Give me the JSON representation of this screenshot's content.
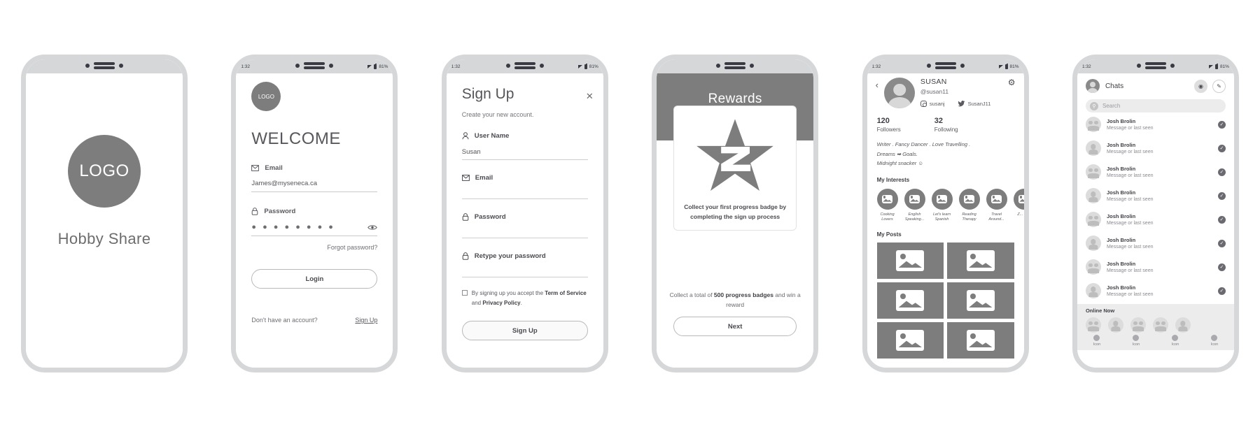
{
  "meta": {
    "status_time": "1:32",
    "battery": "81%",
    "accent_gray": "#7d7d7d",
    "frame_gray": "#d6d7d9"
  },
  "screens": [
    {
      "id": "splash",
      "name": "Splash Screen",
      "logo_text": "LOGO",
      "app_title": "Hobby Share"
    },
    {
      "id": "login",
      "name": "Login Screen",
      "logo_text": "LOGO",
      "heading": "WELCOME",
      "email": {
        "label": "Email",
        "value": "James@myseneca.ca",
        "icon": "envelope-icon"
      },
      "password": {
        "label": "Password",
        "value": "● ● ● ● ● ● ● ●",
        "icon": "lock-icon",
        "toggle_icon": "eye-icon"
      },
      "forgot_label": "Forgot password?",
      "login_button": "Login",
      "footer_question": "Don't have an account?",
      "footer_link": "Sign Up"
    },
    {
      "id": "signup",
      "name": "Sign Up Screen",
      "close_icon": "✕",
      "title": "Sign Up",
      "subtitle": "Create your new account.",
      "fields": [
        {
          "label": "User Name",
          "value": "Susan",
          "icon": "user-icon"
        },
        {
          "label": "Email",
          "value": "",
          "icon": "envelope-icon"
        },
        {
          "label": "Password",
          "value": "",
          "icon": "lock-icon"
        },
        {
          "label": "Retype your password",
          "value": "",
          "icon": "lock-icon"
        }
      ],
      "terms_prefix": "By signing up you accept the ",
      "terms_link_1": "Term of Service",
      "terms_mid": " and ",
      "terms_link_2": "Privacy Policy",
      "terms_suffix": ".",
      "signup_button": "Sign Up"
    },
    {
      "id": "rewards",
      "name": "Rewards Screen",
      "title": "Rewards",
      "badge_icon": "star-z-badge-icon",
      "card_caption": "Collect your first progress badge by completing the sign up process",
      "sub_prefix": "Collect a total of ",
      "sub_bold": "500 progress badges",
      "sub_suffix": " and win a reward",
      "next_button": "Next"
    },
    {
      "id": "profile",
      "name": "Profile Screen",
      "back_icon": "chevron-left-icon",
      "settings_icon": "gear-icon",
      "display_name": "SUSAN",
      "handle": "@susan11",
      "socials": [
        {
          "platform": "instagram",
          "handle": "susanj"
        },
        {
          "platform": "twitter",
          "handle": "SusanJ11"
        }
      ],
      "stats": [
        {
          "value": "120",
          "label": "Followers"
        },
        {
          "value": "32",
          "label": "Following"
        }
      ],
      "bio_lines": [
        "Writer .  Fancy Dancer .  Love Travelling .",
        "Dreams ➡ Goals.",
        "Midnight snacker ☺"
      ],
      "interests_title": "My Interests",
      "interests": [
        "Cooking Lovers",
        "English Speaking...",
        "Let's learn Spanish",
        "Reading Therapy",
        "Travel Around...",
        "Z... O..."
      ],
      "posts_title": "My Posts",
      "post_count": 6
    },
    {
      "id": "chats",
      "name": "Chats Screen",
      "title": "Chats",
      "camera_icon": "camera-icon",
      "compose_icon": "pencil-icon",
      "search_placeholder": "Search",
      "search_icon": "search-icon",
      "chats": [
        {
          "name": "Josh Brolin",
          "preview": "Message or last seen",
          "avatar": "group",
          "status_icon": "check-circle-icon"
        },
        {
          "name": "Josh Brolin",
          "preview": "Message or last seen",
          "avatar": "single",
          "status_icon": "check-circle-icon"
        },
        {
          "name": "Josh Brolin",
          "preview": "Message or last seen",
          "avatar": "group",
          "status_icon": "check-circle-icon"
        },
        {
          "name": "Josh Brolin",
          "preview": "Message or last seen",
          "avatar": "single",
          "status_icon": "check-circle-icon"
        },
        {
          "name": "Josh Brolin",
          "preview": "Message or last seen",
          "avatar": "group",
          "status_icon": "check-circle-icon"
        },
        {
          "name": "Josh Brolin",
          "preview": "Message or last seen",
          "avatar": "single",
          "status_icon": "check-circle-icon"
        },
        {
          "name": "Josh Brolin",
          "preview": "Message or last seen",
          "avatar": "group",
          "status_icon": "check-circle-icon"
        },
        {
          "name": "Josh Brolin",
          "preview": "Message or last seen",
          "avatar": "single",
          "status_icon": "check-circle-icon"
        }
      ],
      "online_label": "Online Now",
      "online_count": 5,
      "tabs": [
        {
          "label": "Icon"
        },
        {
          "label": "Icon"
        },
        {
          "label": "Icon"
        },
        {
          "label": "Icon"
        }
      ]
    }
  ]
}
